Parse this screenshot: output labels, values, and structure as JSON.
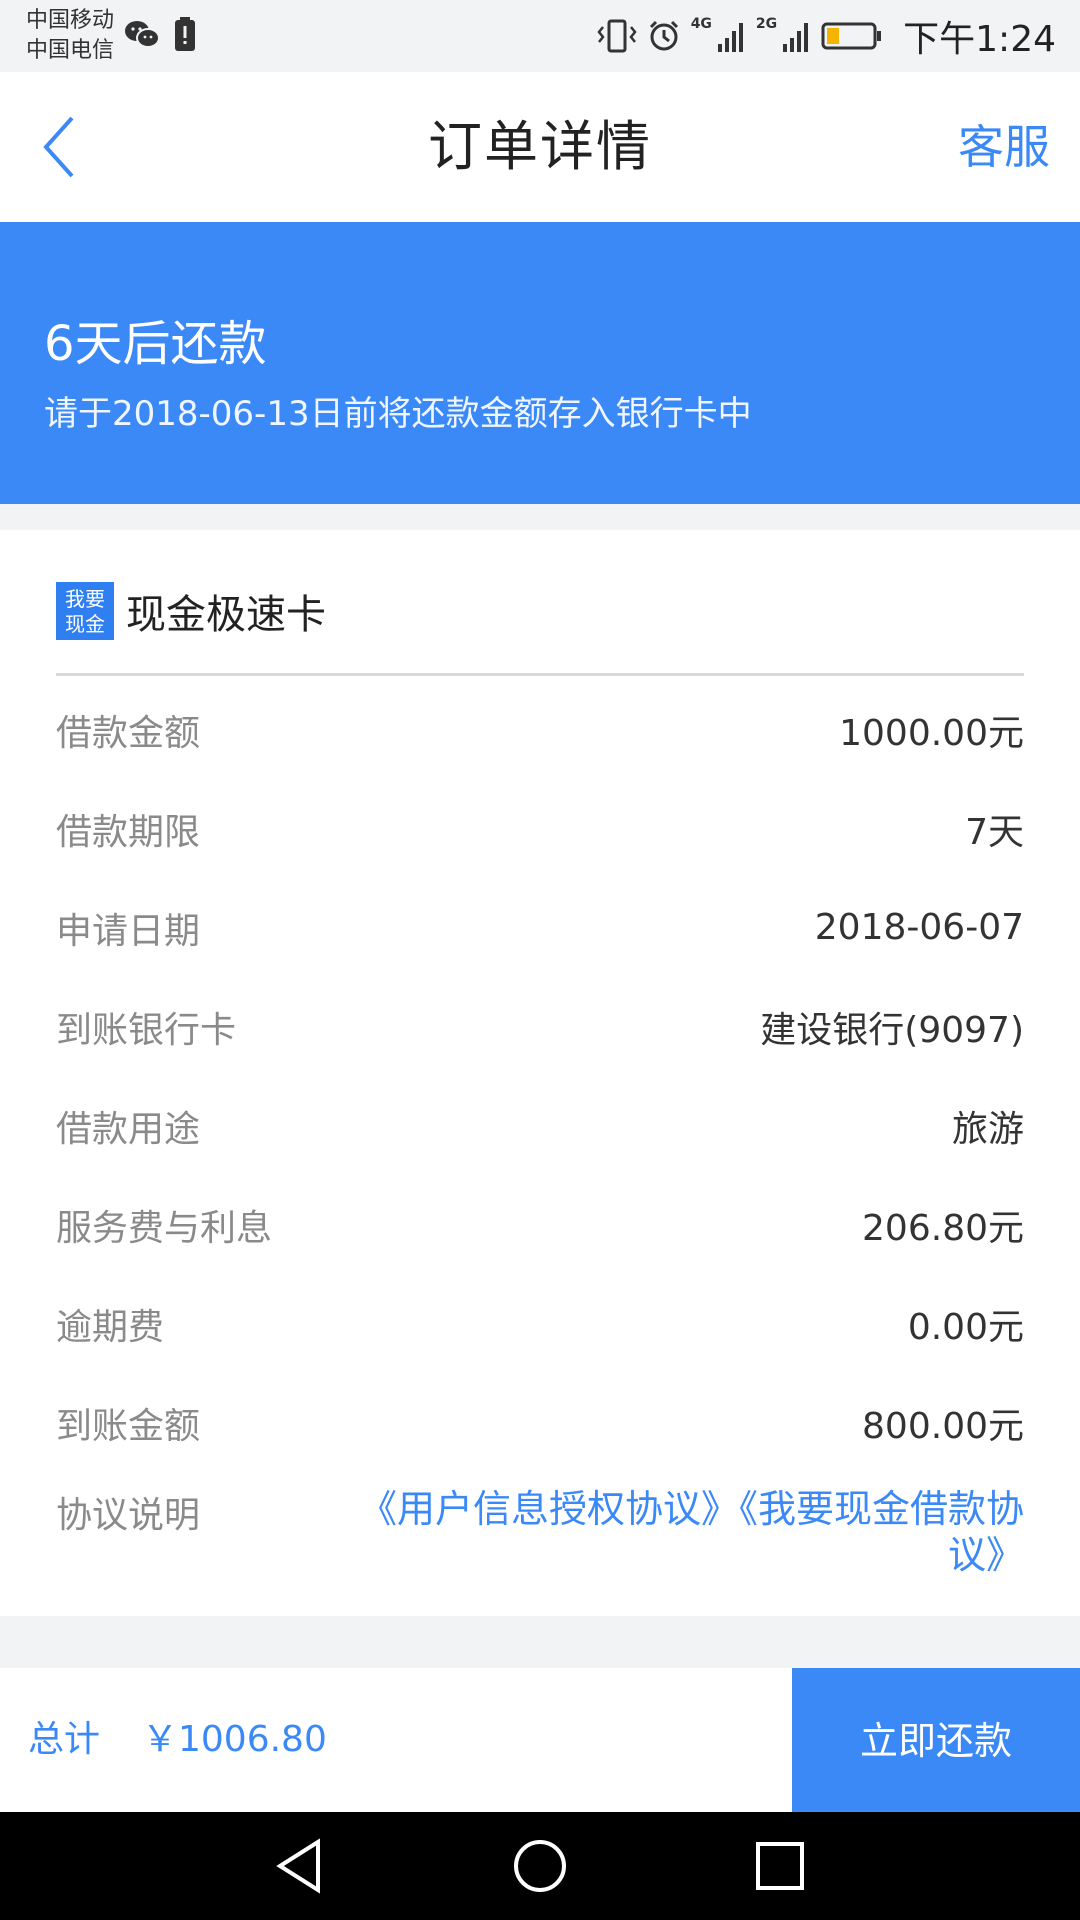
{
  "status_bar": {
    "carrier_1": "中国移动",
    "carrier_2": "中国电信",
    "time": "下午1:24",
    "net_1": "4G",
    "net_2": "2G",
    "icons": [
      "wechat-icon",
      "battery-saver-icon",
      "vibrate-icon",
      "alarm-icon",
      "signal-icon",
      "battery-icon"
    ]
  },
  "nav": {
    "title": "订单详情",
    "right_action": "客服"
  },
  "banner": {
    "title": "6天后还款",
    "subtitle": "请于2018-06-13日前将还款金额存入银行卡中"
  },
  "card": {
    "logo_text": [
      "我要",
      "现金"
    ],
    "name": "现金极速卡",
    "rows": [
      {
        "label": "借款金额",
        "value": "1000.00元"
      },
      {
        "label": "借款期限",
        "value": "7天"
      },
      {
        "label": "申请日期",
        "value": "2018-06-07"
      },
      {
        "label": "到账银行卡",
        "value": "建设银行(9097)"
      },
      {
        "label": "借款用途",
        "value": "旅游"
      },
      {
        "label": "服务费与利息",
        "value": "206.80元"
      },
      {
        "label": "逾期费",
        "value": "0.00元"
      },
      {
        "label": "到账金额",
        "value": "800.00元"
      }
    ],
    "agreement": {
      "label": "协议说明",
      "link_1": "《用户信息授权协议》",
      "link_2": "《我要现金借款协议》"
    }
  },
  "bottom": {
    "total_label": "总计",
    "total_amount": "￥1006.80",
    "action": "立即还款"
  },
  "colors": {
    "primary": "#3b89f7",
    "background": "#f2f3f5"
  }
}
